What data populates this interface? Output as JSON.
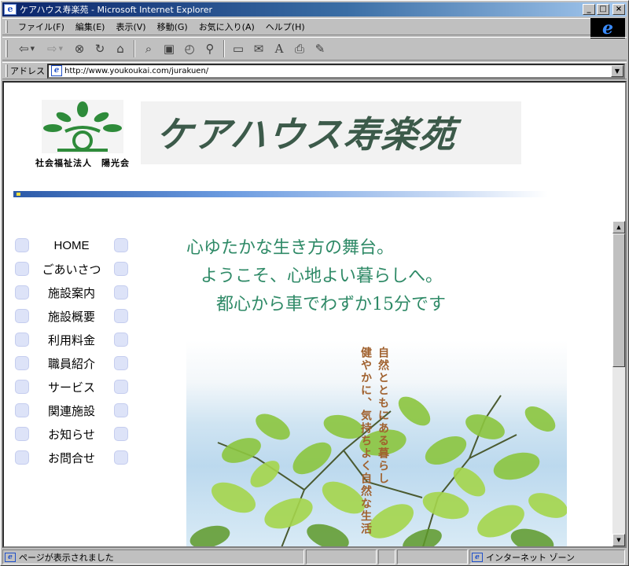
{
  "window": {
    "title": "ケアハウス寿楽苑 - Microsoft Internet Explorer",
    "buttons": {
      "minimize": "_",
      "maximize": "□",
      "close": "×"
    }
  },
  "menubar": {
    "items": [
      "ファイル(F)",
      "編集(E)",
      "表示(V)",
      "移動(G)",
      "お気に入り(A)",
      "ヘルプ(H)"
    ]
  },
  "toolbar": {
    "icons": [
      "back-icon",
      "forward-icon",
      "stop-icon",
      "refresh-icon",
      "home-icon",
      "search-icon",
      "favorites-icon",
      "history-icon",
      "channels-icon",
      "fullscreen-icon",
      "mail-icon",
      "font-icon",
      "print-icon",
      "edit-icon"
    ]
  },
  "address": {
    "label": "アドレス",
    "url": "http://www.youkoukai.com/jurakuen/"
  },
  "page": {
    "org_name": "社会福祉法人　陽光会",
    "site_title": "ケアハウス寿楽苑",
    "nav": [
      "HOME",
      "ごあいさつ",
      "施設案内",
      "施設概要",
      "利用料金",
      "職員紹介",
      "サービス",
      "関連施設",
      "お知らせ",
      "お問合せ"
    ],
    "slogan": [
      "心ゆたかな生き方の舞台。",
      "ようこそ、心地よい暮らしへ。",
      "都心から車でわずか15分です"
    ],
    "photo_caption": [
      "自然とともにある暮らし",
      "健やかに、気持ちよく自然な生活"
    ],
    "colors": {
      "slogan": "#2f8a67",
      "title": "#3c5a4a",
      "logo_green": "#2e8b3a",
      "caption": "#a0612e"
    }
  },
  "status": {
    "text": "ページが表示されました",
    "zone": "インターネット ゾーン"
  }
}
